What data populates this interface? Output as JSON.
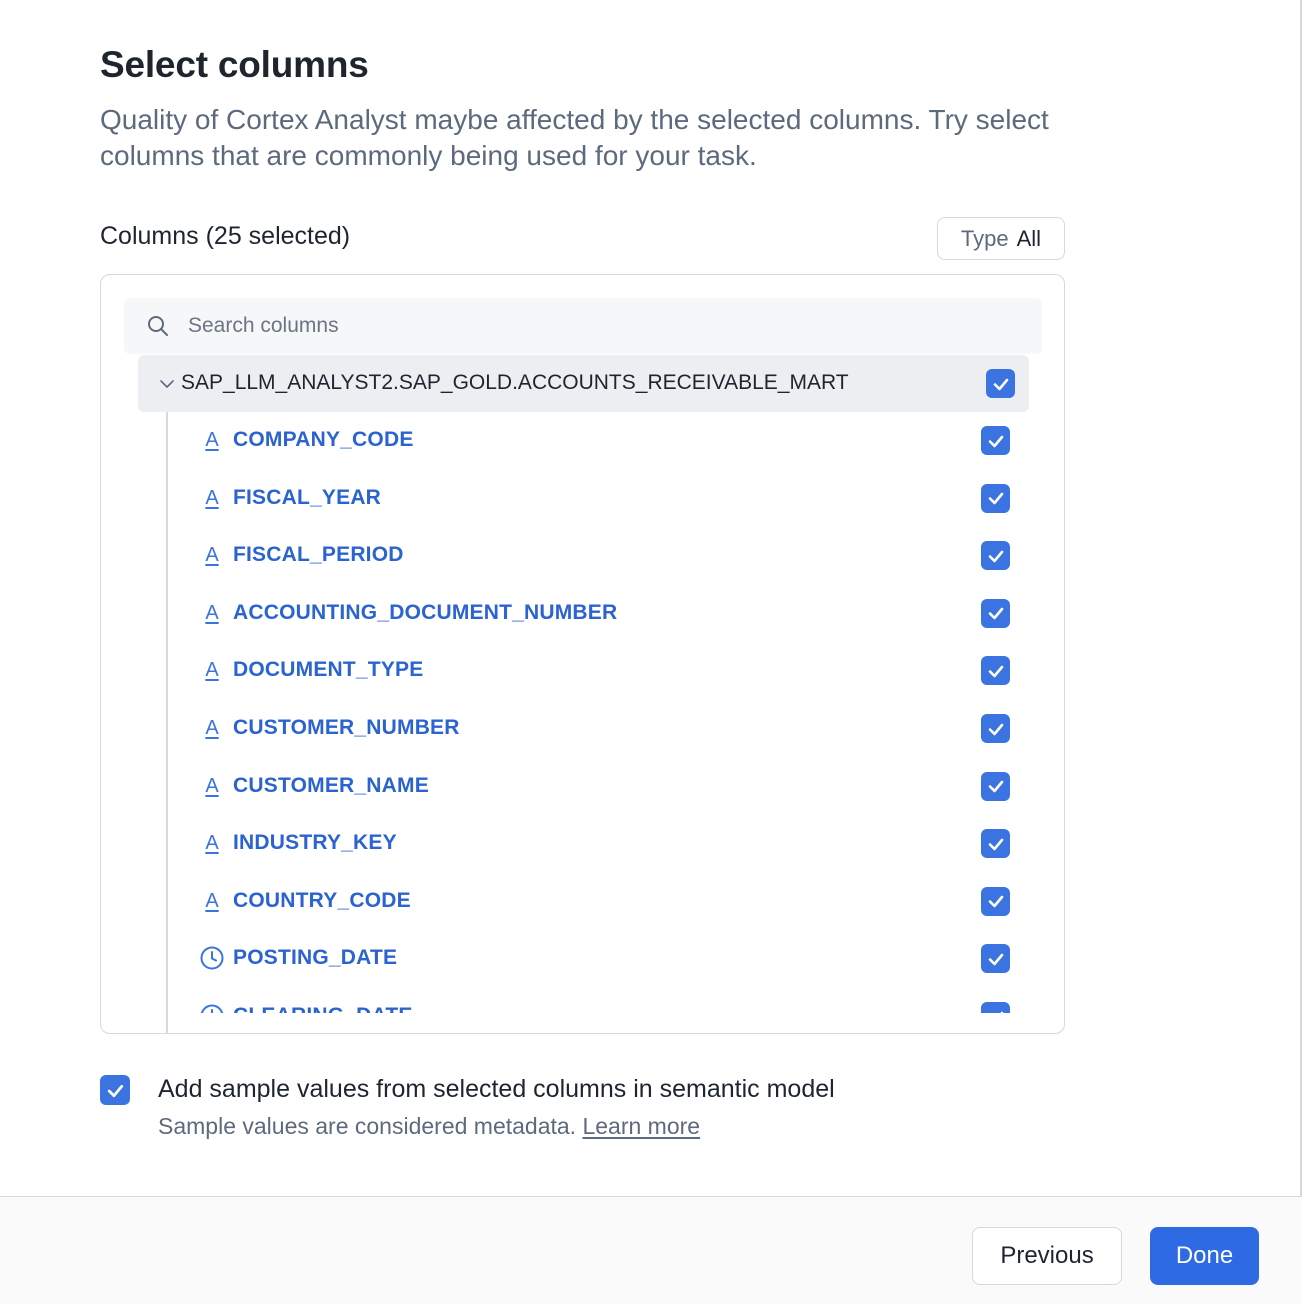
{
  "dialog": {
    "title": "Select columns",
    "subtitle": "Quality of Cortex Analyst maybe affected by the selected columns. Try select columns that are commonly being used for your task."
  },
  "columns_section": {
    "heading": "Columns (25 selected)",
    "type_filter": {
      "label": "Type",
      "value": "All"
    },
    "search": {
      "placeholder": "Search columns",
      "value": ""
    },
    "table": {
      "name": "SAP_LLM_ANALYST2.SAP_GOLD.ACCOUNTS_RECEIVABLE_MART",
      "checked": true,
      "expanded": true,
      "columns": [
        {
          "name": "COMPANY_CODE",
          "type_icon": "text-type-icon",
          "checked": true
        },
        {
          "name": "FISCAL_YEAR",
          "type_icon": "text-type-icon",
          "checked": true
        },
        {
          "name": "FISCAL_PERIOD",
          "type_icon": "text-type-icon",
          "checked": true
        },
        {
          "name": "ACCOUNTING_DOCUMENT_NUMBER",
          "type_icon": "text-type-icon",
          "checked": true
        },
        {
          "name": "DOCUMENT_TYPE",
          "type_icon": "text-type-icon",
          "checked": true
        },
        {
          "name": "CUSTOMER_NUMBER",
          "type_icon": "text-type-icon",
          "checked": true
        },
        {
          "name": "CUSTOMER_NAME",
          "type_icon": "text-type-icon",
          "checked": true
        },
        {
          "name": "INDUSTRY_KEY",
          "type_icon": "text-type-icon",
          "checked": true
        },
        {
          "name": "COUNTRY_CODE",
          "type_icon": "text-type-icon",
          "checked": true
        },
        {
          "name": "POSTING_DATE",
          "type_icon": "clock-icon",
          "checked": true
        },
        {
          "name": "CLEARING_DATE",
          "type_icon": "clock-icon",
          "checked": true
        }
      ]
    }
  },
  "sample_values": {
    "checked": true,
    "label": "Add sample values from selected columns in semantic model",
    "description": "Sample values are considered metadata.",
    "link": "Learn more"
  },
  "footer": {
    "previous_label": "Previous",
    "done_label": "Done"
  },
  "colors": {
    "accent": "#3b73e0",
    "column_text": "#2b63d0",
    "primary_button": "#2d6ae3"
  }
}
